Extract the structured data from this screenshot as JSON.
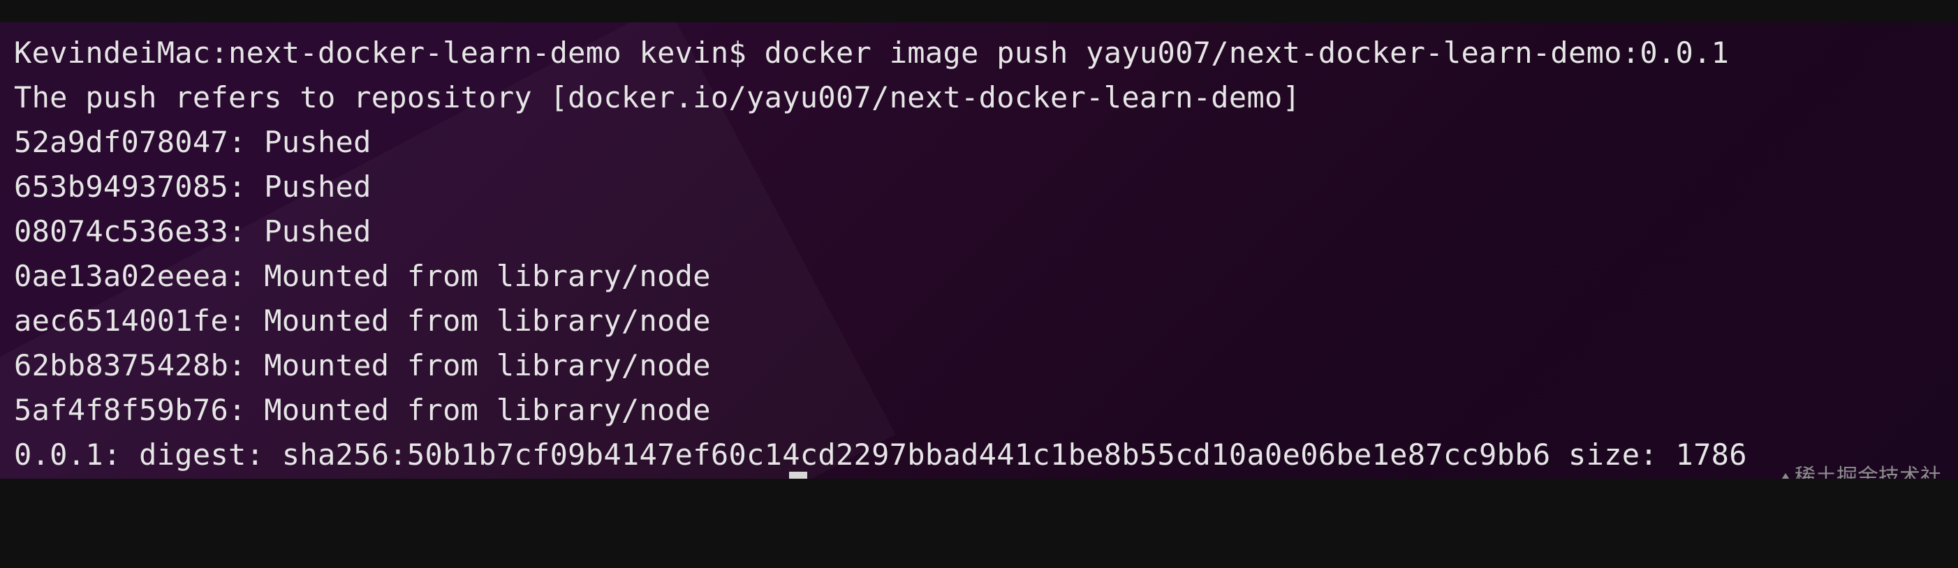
{
  "terminal": {
    "lines": [
      "KevindeiMac:next-docker-learn-demo kevin$ docker image push yayu007/next-docker-learn-demo:0.0.1",
      "The push refers to repository [docker.io/yayu007/next-docker-learn-demo]",
      "52a9df078047: Pushed",
      "653b94937085: Pushed",
      "08074c536e33: Pushed",
      "0ae13a02eeea: Mounted from library/node",
      "aec6514001fe: Mounted from library/node",
      "62bb8375428b: Mounted from library/node",
      "5af4f8f59b76: Mounted from library/node",
      "0.0.1: digest: sha256:50b1b7cf09b4147ef60c14cd2297bbad441c1be8b55cd10a0e06be1e87cc9bb6 size: 1786"
    ],
    "cursor_icon": "block-cursor"
  },
  "watermark": {
    "text": "稀土掘金技术社",
    "icon": "juejin-logo-icon"
  }
}
